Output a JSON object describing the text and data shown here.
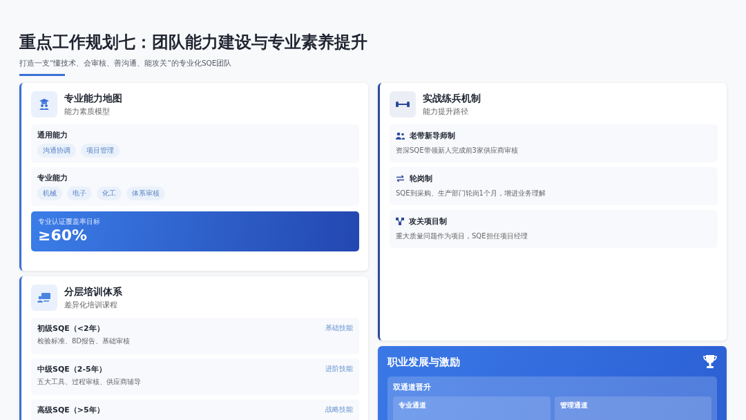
{
  "header": {
    "title": "重点工作规划七：团队能力建设与专业素养提升",
    "subtitle": "打造一支“懂技术、会审核、善沟通、能攻关”的专业化SQE团队"
  },
  "competency_map": {
    "title": "专业能力地图",
    "subtitle": "能力素质模型",
    "groups": [
      {
        "label": "通用能力",
        "tags": [
          "沟通协调",
          "项目管理"
        ]
      },
      {
        "label": "专业能力",
        "tags": [
          "机械",
          "电子",
          "化工",
          "体系审核"
        ]
      }
    ],
    "target": {
      "label": "专业认证覆盖率目标",
      "value": "≥60%"
    }
  },
  "training": {
    "title": "分层培训体系",
    "subtitle": "差异化培训课程",
    "levels": [
      {
        "name": "初级SQE（<2年）",
        "courses": "检验标准、8D报告、基础审核",
        "tag": "基础技能"
      },
      {
        "name": "中级SQE（2-5年）",
        "courses": "五大工具、过程审核、供应商辅导",
        "tag": "进阶技能"
      },
      {
        "name": "高级SQE（>5年）",
        "tag": "战略技能"
      }
    ]
  },
  "practice": {
    "title": "实战练兵机制",
    "subtitle": "能力提升路径",
    "items": [
      {
        "kind": "mentor",
        "title": "老带新导师制",
        "desc": "资深SQE带领新人完成前3家供应商审核"
      },
      {
        "kind": "rotation",
        "title": "轮岗制",
        "desc": "SQE到采购、生产部门轮岗1个月，增进业务理解"
      },
      {
        "kind": "project",
        "title": "攻关项目制",
        "desc": "重大质量问题作为项目，SQE担任项目经理"
      }
    ]
  },
  "career": {
    "title": "职业发展与激励",
    "panel_title": "双通道晋升",
    "channels": [
      "专业通道",
      "管理通道"
    ]
  }
}
